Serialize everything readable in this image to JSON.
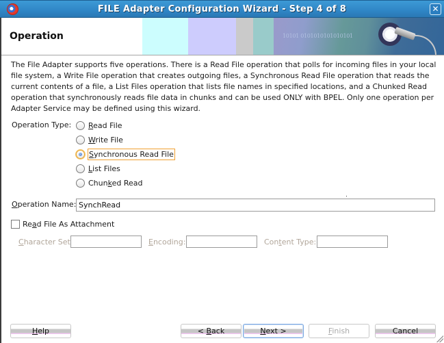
{
  "window": {
    "title": "FILE Adapter Configuration Wizard - Step 4 of 8",
    "close_glyph": "✕",
    "icons": {
      "app": "oracle-app-icon",
      "close": "close-icon"
    }
  },
  "header": {
    "title": "Operation",
    "banner_text": "10101 0101010101010101",
    "banner_icon": "adapter-gear-plug-icon"
  },
  "description": "The File Adapter supports five operations.  There is a Read File operation that polls for incoming files in your local file system, a Write File operation that creates outgoing files, a Synchronous Read File operation that reads the current contents of a file, a List Files operation that lists file names in specified locations, and a Chunked Read operation that synchronously reads file data in chunks and can be used ONLY with BPEL. Only one operation per Adapter Service may be defined using this wizard.",
  "operation_type": {
    "label": "Operation Type:",
    "options": [
      {
        "pre": "",
        "mnemonic": "R",
        "post": "ead File",
        "selected": false
      },
      {
        "pre": "",
        "mnemonic": "W",
        "post": "rite File",
        "selected": false
      },
      {
        "pre": "",
        "mnemonic": "S",
        "post": "ynchronous Read File",
        "selected": true
      },
      {
        "pre": "",
        "mnemonic": "L",
        "post": "ist Files",
        "selected": false
      },
      {
        "pre": "Chun",
        "mnemonic": "k",
        "post": "ed Read",
        "selected": false
      }
    ],
    "selected_value": "Synchronous Read File"
  },
  "operation_name": {
    "label_mnemonic": "O",
    "label_rest": "peration Name:",
    "value": "SynchRead"
  },
  "attachment": {
    "label_pre": "Re",
    "label_mnemonic": "a",
    "label_post": "d File As Attachment",
    "checked": false
  },
  "attachment_fields": {
    "character_set": {
      "mnemonic": "C",
      "rest": "haracter Set:",
      "value": ""
    },
    "encoding": {
      "mnemonic": "E",
      "rest": "ncoding:",
      "value": ""
    },
    "content_type": {
      "pre": "Con",
      "mnemonic": "t",
      "rest": "ent Type:",
      "value": ""
    }
  },
  "buttons": {
    "help": {
      "mnemonic": "H",
      "rest": "elp"
    },
    "back": {
      "pre": "< ",
      "mnemonic": "B",
      "rest": "ack"
    },
    "next": {
      "mnemonic": "N",
      "rest": "ext >"
    },
    "finish": {
      "mnemonic": "F",
      "rest": "inish",
      "enabled": false
    },
    "cancel": {
      "label": "Cancel"
    }
  }
}
